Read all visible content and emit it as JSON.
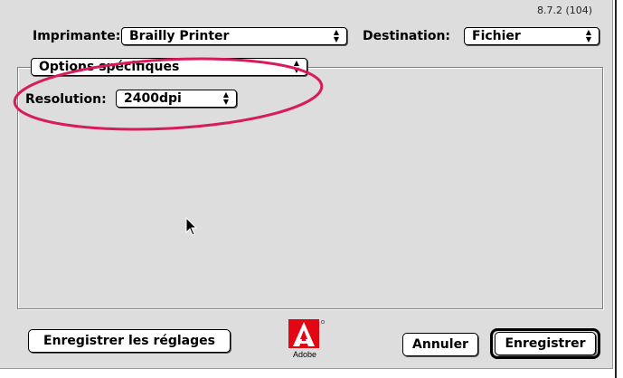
{
  "version": "8.7.2 (104)",
  "printer": {
    "label": "Imprimante:",
    "value": "Brailly Printer"
  },
  "destination": {
    "label": "Destination:",
    "value": "Fichier"
  },
  "options_popup": {
    "value": "Options spécifiques"
  },
  "resolution": {
    "label": "Resolution:",
    "value": "2400dpi"
  },
  "buttons": {
    "save_settings": "Enregistrer les réglages",
    "cancel": "Annuler",
    "save": "Enregistrer"
  },
  "logo": {
    "brand": "Adobe"
  },
  "annotation_color": "#d81b5a",
  "icons": [
    "popup-arrows-icon",
    "adobe-logo-icon",
    "mouse-cursor-icon"
  ]
}
